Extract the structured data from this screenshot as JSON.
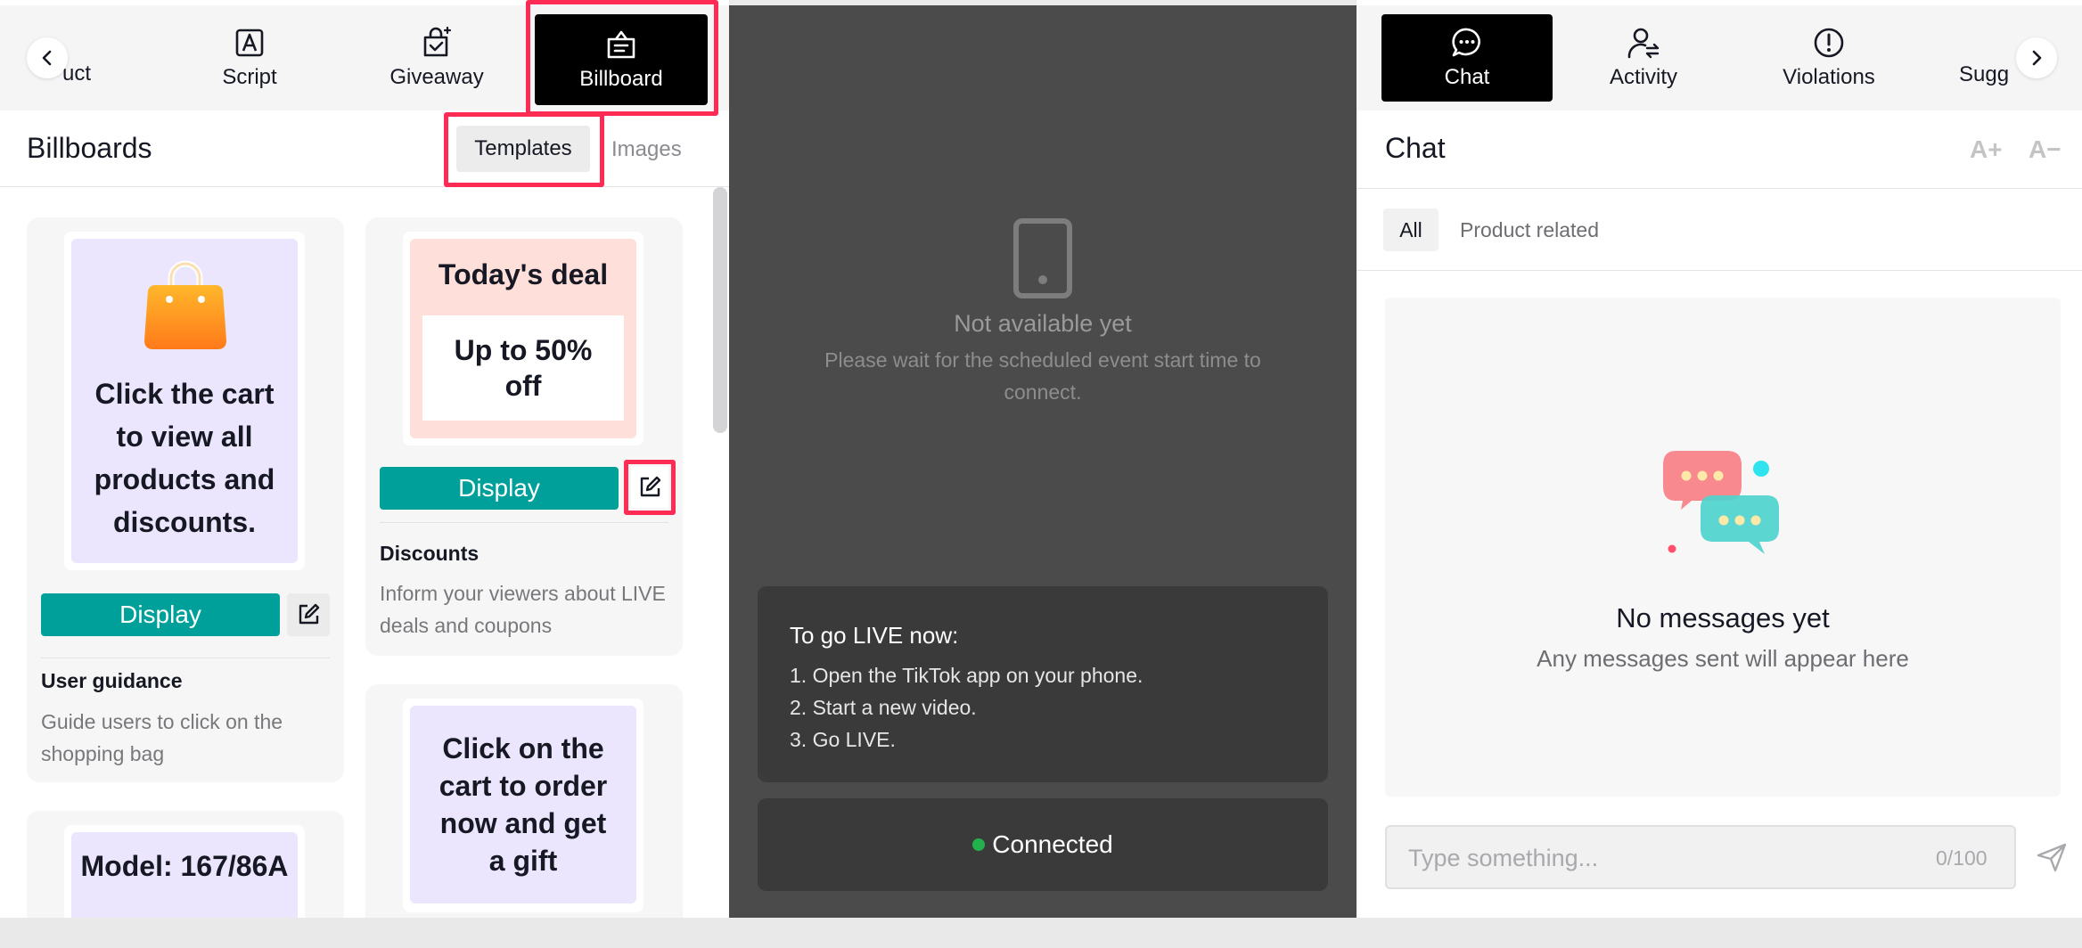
{
  "left_tabs": {
    "partial_label": "uct",
    "items": [
      {
        "label": "Script"
      },
      {
        "label": "Giveaway"
      },
      {
        "label": "Billboard"
      }
    ]
  },
  "billboards": {
    "title": "Billboards",
    "subtabs": [
      "Templates",
      "Images"
    ],
    "cards": [
      {
        "preview_text": "Click the cart to view all products and discounts.",
        "display_label": "Display",
        "title": "User guidance",
        "description": "Guide users to click on the shopping bag"
      },
      {
        "preview_heading": "Today's deal",
        "preview_text": "Up to 50% off",
        "display_label": "Display",
        "title": "Discounts",
        "description": "Inform your viewers about LIVE deals and coupons"
      },
      {
        "preview_text": "Click on the cart to order now and get a gift"
      },
      {
        "preview_text": "Model: 167/86A"
      }
    ]
  },
  "live_preview": {
    "status_title": "Not available yet",
    "status_desc": "Please wait for the scheduled event start time to connect.",
    "instructions_title": "To go LIVE now:",
    "instructions": [
      "1. Open the TikTok app on your phone.",
      "2. Start a new video.",
      "3. Go LIVE."
    ],
    "connection": "Connected",
    "connection_color": "#22b14c"
  },
  "right_tabs": {
    "items": [
      {
        "label": "Chat"
      },
      {
        "label": "Activity"
      },
      {
        "label": "Violations"
      }
    ],
    "partial_label": "Sugg"
  },
  "chat": {
    "title": "Chat",
    "font_up": "A+",
    "font_down": "A−",
    "filters": [
      "All",
      "Product related"
    ],
    "empty_title": "No messages yet",
    "empty_desc": "Any messages sent will appear here",
    "input_placeholder": "Type something...",
    "char_count": "0/100"
  },
  "colors": {
    "accent": "#00a09a",
    "highlight": "#fe2c55",
    "active_tab": "#000000"
  }
}
